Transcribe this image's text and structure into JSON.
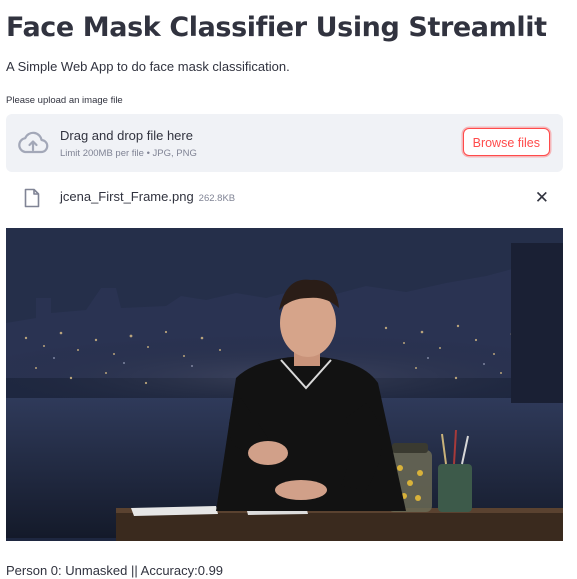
{
  "header": {
    "title": "Face Mask Classifier Using Streamlit",
    "subtitle": "A Simple Web App to do face mask classification."
  },
  "uploader": {
    "label": "Please upload an image file",
    "drag_text": "Drag and drop file here",
    "limit_text": "Limit 200MB per file • JPG, PNG",
    "browse_label": "Browse files",
    "upload_icon": "cloud-upload-icon"
  },
  "uploaded_file": {
    "name": "jcena_First_Frame.png",
    "size": "262.8KB",
    "file_icon": "file-icon",
    "remove_label": "✕"
  },
  "image": {
    "description_icon": "uploaded-photo"
  },
  "result": {
    "text": "Person 0: Unmasked || Accuracy:0.99"
  },
  "colors": {
    "accent": "#ff4b4b",
    "text": "#31333f",
    "muted": "#808495",
    "dropzone_bg": "#f0f2f6"
  }
}
